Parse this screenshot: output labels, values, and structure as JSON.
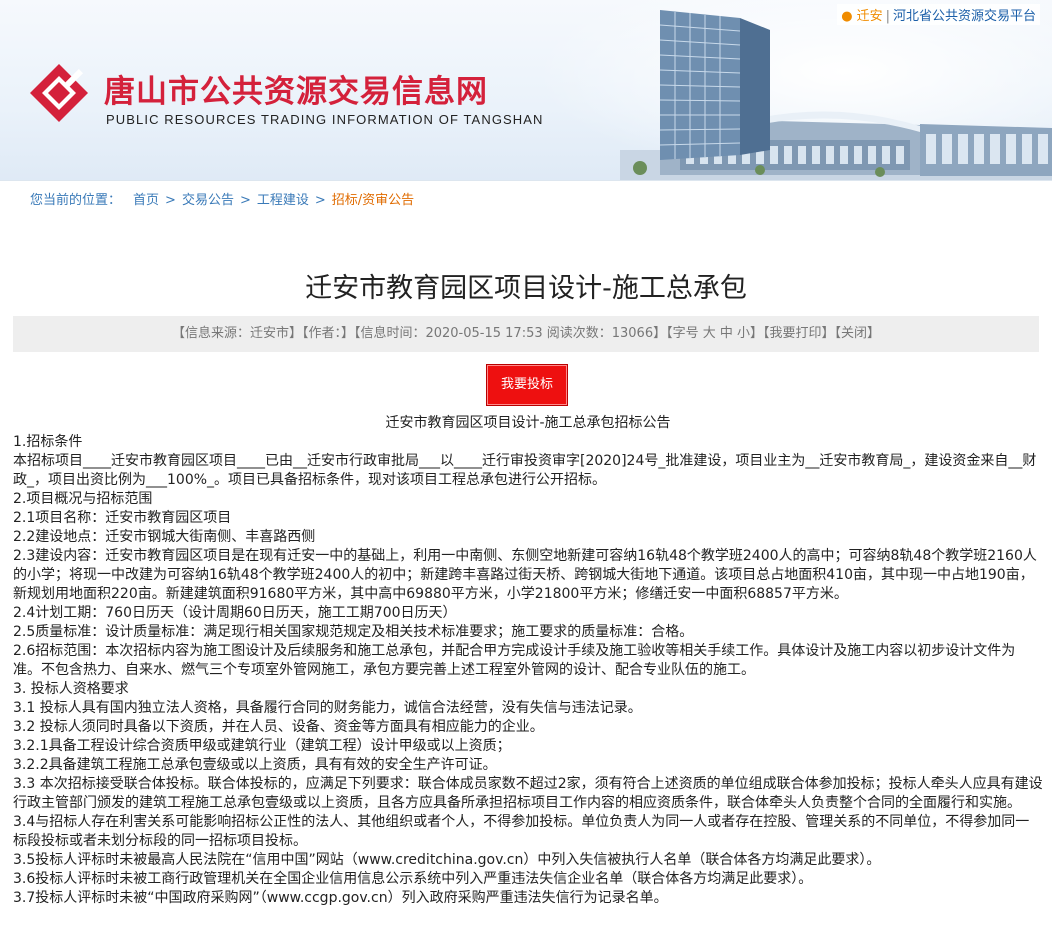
{
  "header": {
    "title_cn": "唐山市公共资源交易信息网",
    "title_en": "PUBLIC RESOURCES TRADING INFORMATION OF TANGSHAN",
    "city_link": "迁安",
    "separator": "|",
    "province_link": "河北省公共资源交易平台",
    "brand_color": "#d4213b"
  },
  "breadcrumb": {
    "label": "您当前的位置：",
    "items": [
      "首页",
      "交易公告",
      "工程建设"
    ],
    "current": "招标/资审公告",
    "arrow": ">"
  },
  "article": {
    "title": "迁安市教育园区项目设计-施工总承包",
    "meta": {
      "source": "【信息来源：迁安市】",
      "author": "【作者：】",
      "time": "【信息时间：2020-05-15 17:53 阅读次数：13066】",
      "font_size": "【字号 大 中 小】",
      "print": "【我要打印】",
      "close": "【关闭】"
    },
    "bid_button": "我要投标"
  },
  "notice": {
    "title": "迁安市教育园区项目设计-施工总承包招标公告",
    "lines": [
      "1.招标条件",
      "本招标项目____迁安市教育园区项目____已由__迁安市行政审批局___以____迁行审投资审字[2020]24号_批准建设，项目业主为__迁安市教育局_，建设资金来自__财政_，项目出资比例为___100%_。项目已具备招标条件，现对该项目工程总承包进行公开招标。",
      "2.项目概况与招标范围",
      "2.1项目名称：迁安市教育园区项目",
      "2.2建设地点：迁安市钢城大街南侧、丰喜路西侧",
      "2.3建设内容：迁安市教育园区项目是在现有迁安一中的基础上，利用一中南侧、东侧空地新建可容纳16轨48个教学班2400人的高中；可容纳8轨48个教学班2160人的小学；将现一中改建为可容纳16轨48个教学班2400人的初中；新建跨丰喜路过街天桥、跨钢城大街地下通道。该项目总占地面积410亩，其中现一中占地190亩，新规划用地面积220亩。新建建筑面积91680平方米，其中高中69880平方米，小学21800平方米；修缮迁安一中面积68857平方米。",
      "2.4计划工期：760日历天（设计周期60日历天，施工工期700日历天）",
      "2.5质量标准：设计质量标准：满足现行相关国家规范规定及相关技术标准要求；施工要求的质量标准：合格。",
      "2.6招标范围：本次招标内容为施工图设计及后续服务和施工总承包，并配合甲方完成设计手续及施工验收等相关手续工作。具体设计及施工内容以初步设计文件为准。不包含热力、自来水、燃气三个专项室外管网施工，承包方要完善上述工程室外管网的设计、配合专业队伍的施工。",
      "3. 投标人资格要求",
      "3.1 投标人具有国内独立法人资格，具备履行合同的财务能力，诚信合法经营，没有失信与违法记录。",
      "3.2 投标人须同时具备以下资质，并在人员、设备、资金等方面具有相应能力的企业。",
      "3.2.1具备工程设计综合资质甲级或建筑行业（建筑工程）设计甲级或以上资质；",
      "3.2.2具备建筑工程施工总承包壹级或以上资质，具有有效的安全生产许可证。",
      "3.3 本次招标接受联合体投标。联合体投标的，应满足下列要求：联合体成员家数不超过2家，须有符合上述资质的单位组成联合体参加投标；投标人牵头人应具有建设行政主管部门颁发的建筑工程施工总承包壹级或以上资质，且各方应具备所承担招标项目工作内容的相应资质条件，联合体牵头人负责整个合同的全面履行和实施。",
      "3.4与招标人存在利害关系可能影响招标公正性的法人、其他组织或者个人，不得参加投标。单位负责人为同一人或者存在控股、管理关系的不同单位，不得参加同一标段投标或者未划分标段的同一招标项目投标。",
      "3.5投标人评标时未被最高人民法院在“信用中国”网站（www.creditchina.gov.cn）中列入失信被执行人名单（联合体各方均满足此要求）。",
      "3.6投标人评标时未被工商行政管理机关在全国企业信用信息公示系统中列入严重违法失信企业名单（联合体各方均满足此要求）。",
      "3.7投标人评标时未被“中国政府采购网”（www.ccgp.gov.cn）列入政府采购严重违法失信行为记录名单。"
    ]
  }
}
